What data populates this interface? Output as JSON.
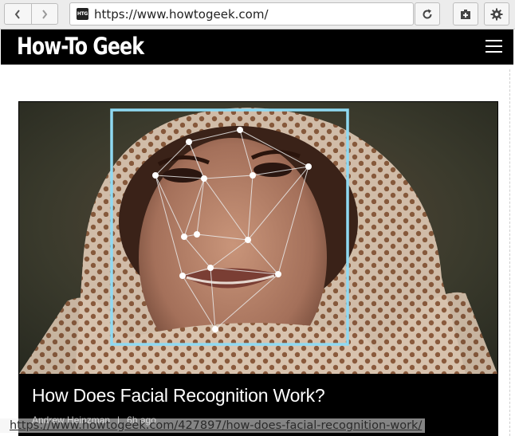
{
  "browser": {
    "url": "https://www.howtogeek.com/",
    "favicon_text": "HTG",
    "back_icon": "chevron-left-icon",
    "forward_icon": "chevron-right-icon",
    "reload_icon": "reload-icon",
    "new_tab_icon": "new-tab-icon",
    "settings_icon": "gear-icon"
  },
  "site": {
    "logo": "How-To Geek",
    "menu_icon": "hamburger-menu-icon"
  },
  "article": {
    "title": "How Does Facial Recognition Work?",
    "author": "Andrew Heinzman",
    "separator": "|",
    "time": "6h ago",
    "image_alt": "face with facial recognition mesh overlay"
  },
  "status": {
    "link_url": "https://www.howtogeek.com/427897/how-does-facial-recognition-work/"
  },
  "colors": {
    "header_bg": "#000000",
    "toolbar_bg": "#ececec",
    "mesh": "#e8e8e8",
    "frame": "#8fd9f2"
  }
}
